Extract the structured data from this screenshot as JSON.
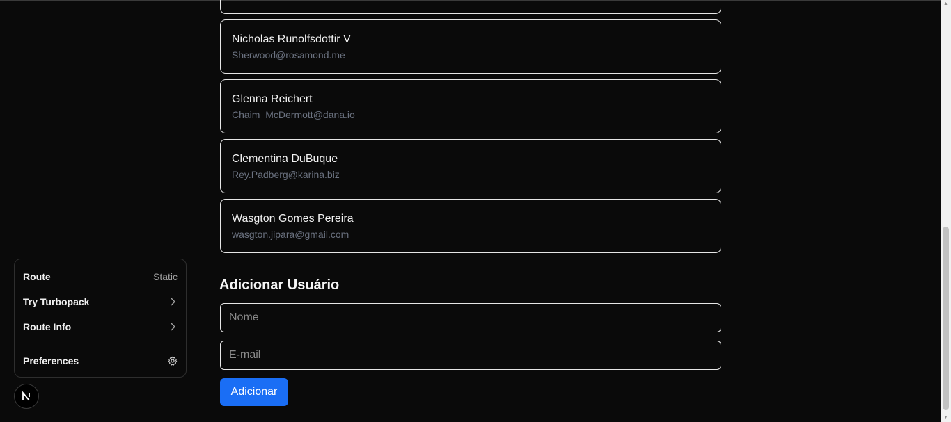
{
  "users": [
    {
      "name": "Nicholas Runolfsdottir V",
      "email": "Sherwood@rosamond.me"
    },
    {
      "name": "Glenna Reichert",
      "email": "Chaim_McDermott@dana.io"
    },
    {
      "name": "Clementina DuBuque",
      "email": "Rey.Padberg@karina.biz"
    },
    {
      "name": "Wasgton Gomes Pereira",
      "email": "wasgton.jipara@gmail.com"
    }
  ],
  "form": {
    "title": "Adicionar Usuário",
    "name_placeholder": "Nome",
    "email_placeholder": "E-mail",
    "submit_label": "Adicionar"
  },
  "dev_tools": {
    "route_label": "Route",
    "route_value": "Static",
    "turbopack_label": "Try Turbopack",
    "route_info_label": "Route Info",
    "preferences_label": "Preferences",
    "badge_letter": "N"
  },
  "colors": {
    "background": "#0a0a0a",
    "accent": "#1a6ef5",
    "card_border": "#e6e6e6",
    "email_text": "#6b7280"
  },
  "icons": {
    "chevron": "chevron-right-icon",
    "preferences": "gear-icon",
    "badge": "nextjs-logo-icon"
  }
}
